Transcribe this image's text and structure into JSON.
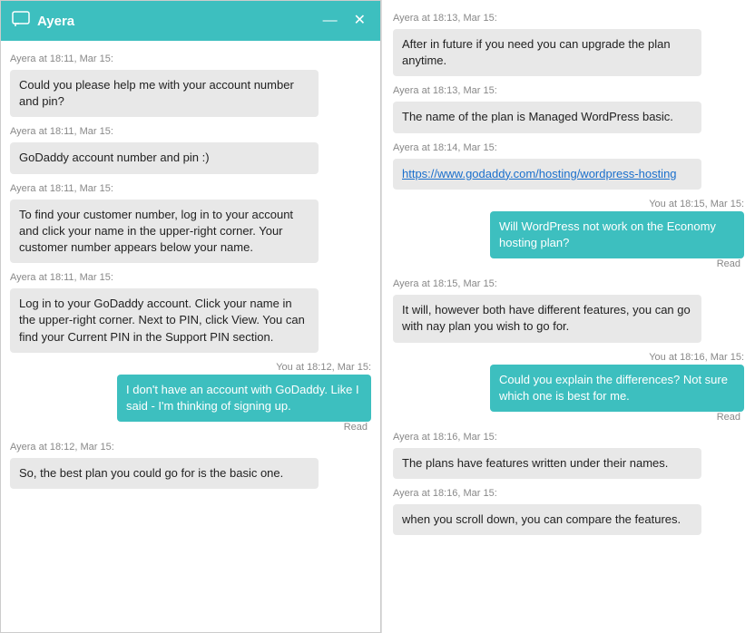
{
  "header": {
    "title": "Ayera",
    "minimize_label": "—",
    "close_label": "✕",
    "chat_icon": "💬"
  },
  "left_messages": [
    {
      "timestamp": "Ayera at 18:11, Mar 15:",
      "text": "Could you please help me with your account number and pin?",
      "type": "agent"
    },
    {
      "timestamp": "Ayera at 18:11, Mar 15:",
      "text": "GoDaddy account number and pin :)",
      "type": "agent"
    },
    {
      "timestamp": "Ayera at 18:11, Mar 15:",
      "text": "To find your customer number, log in to your account and click your name in the upper-right corner. Your customer number appears below your name.",
      "type": "agent"
    },
    {
      "timestamp": "Ayera at 18:11, Mar 15:",
      "text": "Log in to your GoDaddy account. Click your name in the upper-right corner. Next to PIN, click View. You can find your Current PIN in the Support PIN section.",
      "type": "agent"
    },
    {
      "timestamp": "You at 18:12, Mar 15:",
      "text": "I don't have an account with GoDaddy. Like I said - I'm thinking of signing up.",
      "type": "user",
      "read": "Read"
    },
    {
      "timestamp": "Ayera at 18:12, Mar 15:",
      "text": "So, the best plan you could go for is the basic one.",
      "type": "agent"
    }
  ],
  "right_messages": [
    {
      "timestamp": "Ayera at 18:13, Mar 15:",
      "text": "After in future if you need you can upgrade the plan anytime.",
      "type": "agent"
    },
    {
      "timestamp": "Ayera at 18:13, Mar 15:",
      "text": "The name of the plan is Managed WordPress basic.",
      "type": "agent"
    },
    {
      "timestamp": "Ayera at 18:14, Mar 15:",
      "text": "https://www.godaddy.com/hosting/wordpress-hosting",
      "type": "agent",
      "is_link": true
    },
    {
      "timestamp": "You at 18:15, Mar 15:",
      "text": "Will WordPress not work on the Economy hosting plan?",
      "type": "user",
      "read": "Read"
    },
    {
      "timestamp": "Ayera at 18:15, Mar 15:",
      "text": "It will, however both have different features, you can go with nay plan you wish to go for.",
      "type": "agent"
    },
    {
      "timestamp": "You at 18:16, Mar 15:",
      "text": "Could you explain the differences? Not sure which one is best for me.",
      "type": "user",
      "read": "Read"
    },
    {
      "timestamp": "Ayera at 18:16, Mar 15:",
      "text": "The plans have features written under their names.",
      "type": "agent"
    },
    {
      "timestamp": "Ayera at 18:16, Mar 15:",
      "text": "when you scroll down, you can compare the features.",
      "type": "agent"
    }
  ]
}
